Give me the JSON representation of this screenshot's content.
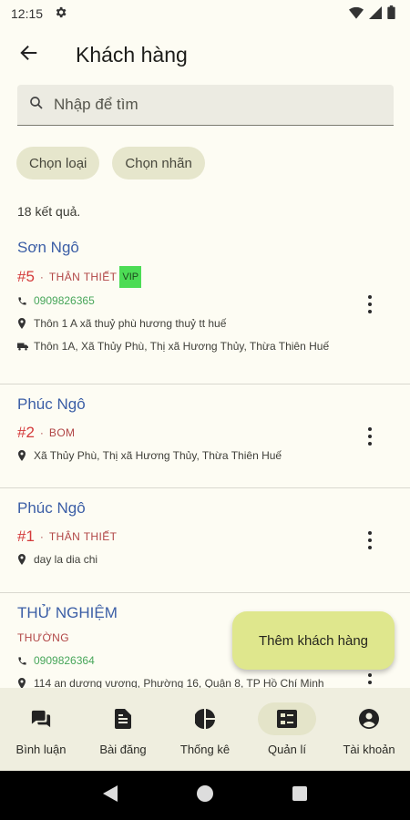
{
  "status_bar": {
    "time": "12:15"
  },
  "header": {
    "title": "Khách hàng"
  },
  "search": {
    "placeholder": "Nhập để tìm"
  },
  "filters": [
    {
      "label": "Chọn loại"
    },
    {
      "label": "Chọn nhãn"
    }
  ],
  "results_text": "18 kết quả.",
  "customers": [
    {
      "name": "Sơn Ngô",
      "number": "#5",
      "type": "THÂN THIẾT",
      "badge": "VIP",
      "phone": "0909826365",
      "address": "Thôn 1 A xã thuỷ phù hương thuỷ tt huế",
      "delivery": "Thôn 1A, Xã Thủy Phù, Thị xã Hương Thủy, Thừa Thiên Huế"
    },
    {
      "name": "Phúc Ngô",
      "number": "#2",
      "type": "BOM",
      "address": "Xã Thủy Phù, Thị xã Hương Thủy, Thừa Thiên Huế"
    },
    {
      "name": "Phúc Ngô",
      "number": "#1",
      "type": "THÂN THIẾT",
      "address": "day la dia chi"
    },
    {
      "name": "THỬ NGHIỆM",
      "type": "THƯỜNG",
      "phone": "0909826364",
      "address": "114 an dương vương, Phường 16, Quận 8, TP Hồ Chí Minh"
    }
  ],
  "fab": {
    "label": "Thêm khách hàng"
  },
  "bottom_nav": [
    {
      "label": "Bình luận",
      "icon": "comments-icon"
    },
    {
      "label": "Bài đăng",
      "icon": "post-icon"
    },
    {
      "label": "Thống kê",
      "icon": "chart-pie-icon"
    },
    {
      "label": "Quản lí",
      "icon": "manage-icon",
      "active": true
    },
    {
      "label": "Tài khoản",
      "icon": "account-icon"
    }
  ],
  "colors": {
    "background": "#fdfcf3",
    "name": "#3b5ea6",
    "number": "#d43b3b",
    "type": "#b14646",
    "vip": "#4cdc55",
    "phone": "#47a65a",
    "fab": "#dfe78d",
    "nav": "#efeedf"
  }
}
